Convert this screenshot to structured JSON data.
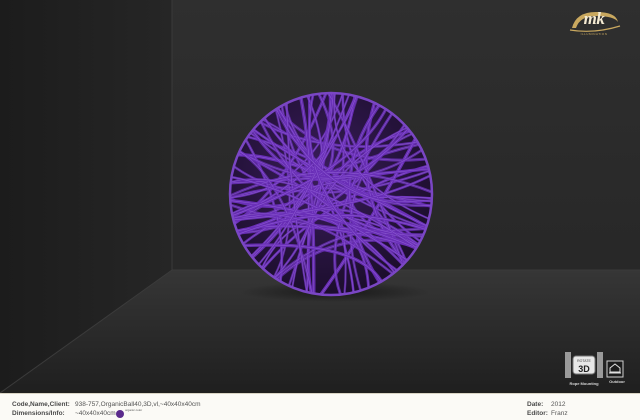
{
  "brand": {
    "logo_text": "mk",
    "logo_sub": "ILLUMINATION"
  },
  "viewer": {
    "product_color": "#6a2fb8"
  },
  "tools": {
    "rope_mounting_label": "Rope Mounting",
    "rope_badge": "3D",
    "rope_badge_small": "ROTATE",
    "outdoor_label": "Outdoor"
  },
  "info": {
    "code_label": "Code,Name,Client:",
    "code_value": "938-757,OrganicBall40,3D,vl,~40x40x40cm",
    "dimensions_label": "Dimensions/Info:",
    "dimensions_value": "~40x40x40cm",
    "swatch_label": "organic color",
    "swatch_color": "#5a2a8c",
    "date_label": "Date:",
    "date_value": "2012",
    "editor_label": "Editor:",
    "editor_value": "Franz"
  }
}
